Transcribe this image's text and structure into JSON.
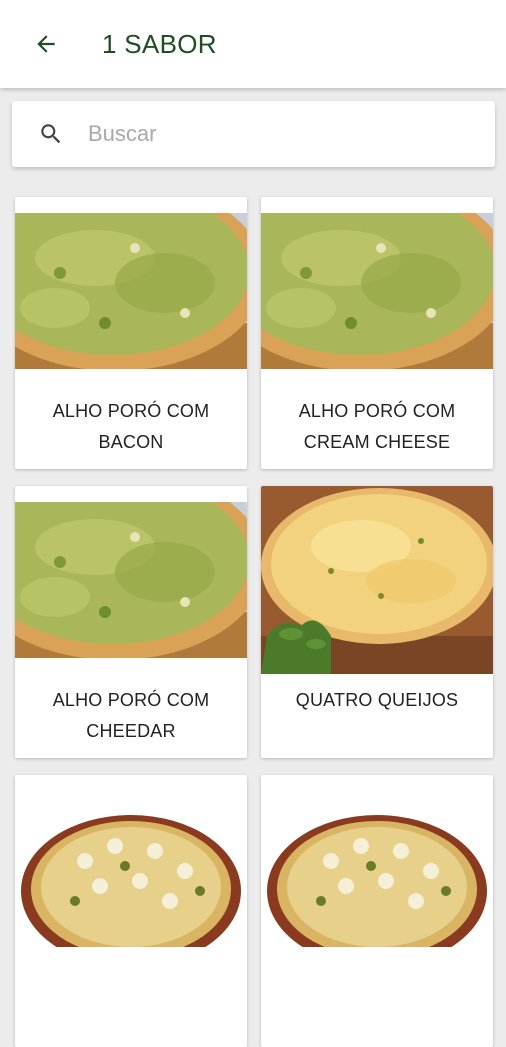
{
  "appbar": {
    "title": "1 SABOR",
    "back_icon": "arrow-back-icon"
  },
  "search": {
    "placeholder": "Buscar",
    "icon": "search-icon"
  },
  "colors": {
    "title_green": "#1f4d24",
    "background": "#ececec"
  },
  "products": [
    {
      "name": "ALHO PORÓ COM BACON",
      "image": "leek-pizza"
    },
    {
      "name": "ALHO PORÓ COM CREAM CHEESE",
      "image": "leek-pizza"
    },
    {
      "name": "ALHO PORÓ COM CHEEDAR",
      "image": "leek-pizza"
    },
    {
      "name": "QUATRO QUEIJOS",
      "image": "four-cheese-pizza"
    },
    {
      "name": "",
      "image": "palm-heart-pizza"
    },
    {
      "name": "",
      "image": "palm-heart-pizza"
    }
  ]
}
